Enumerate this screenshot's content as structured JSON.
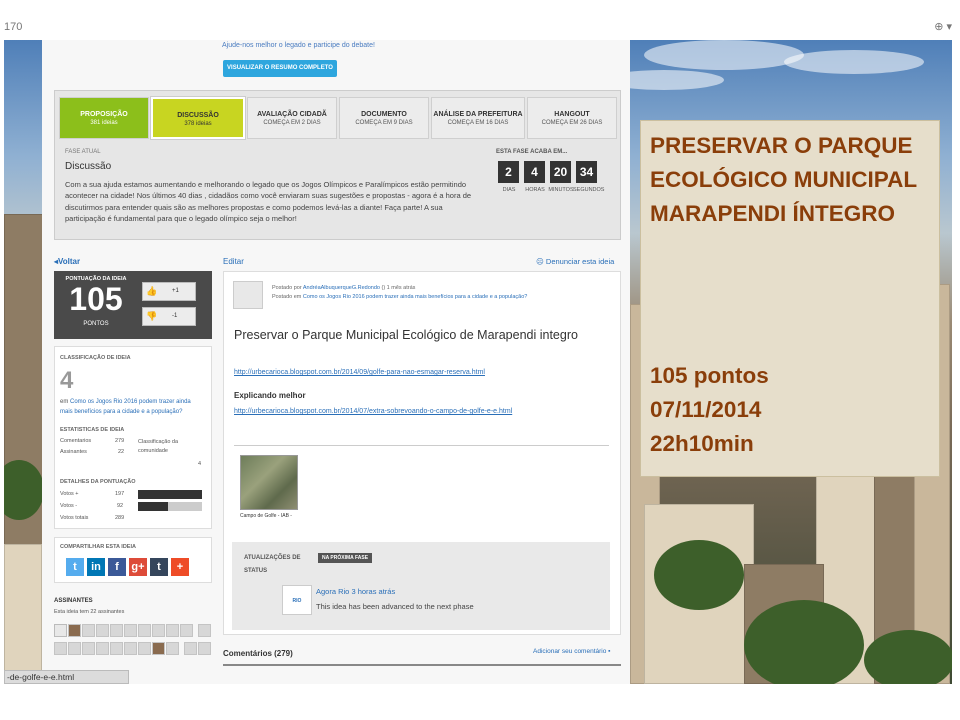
{
  "browser": {
    "url_fragment": "170"
  },
  "site": {
    "topline": "Ajude-nos melhor o legado e participe do debate!",
    "resumo_button": "VISUALIZAR O RESUMO COMPLETO",
    "phases": [
      {
        "label": "PROPOSIÇÃO",
        "sub": "381 ideias"
      },
      {
        "label": "DISCUSSÃO",
        "sub": "378 ideias"
      },
      {
        "label": "AVALIAÇÃO CIDADÃ",
        "sub": "COMEÇA EM 2 DIAS"
      },
      {
        "label": "DOCUMENTO",
        "sub": "COMEÇA EM 9 DIAS"
      },
      {
        "label": "ANÁLISE DA PREFEITURA",
        "sub": "COMEÇA EM 16 DIAS"
      },
      {
        "label": "HANGOUT",
        "sub": "COMEÇA EM 26 DIAS"
      }
    ],
    "fase_label": "FASE ATUAL",
    "fase_title": "Discussão",
    "fase_text": "Com a sua ajuda estamos aumentando e melhorando o legado que os Jogos Olímpicos e Paralímpicos estão permitindo acontecer na cidade! Nos últimos 40 dias , cidadãos como você enviaram suas sugestões e propostas - agora é a hora de discutirmos para entender quais são as melhores propostas e como podemos levá-las a diante! Faça parte! A sua participação é fundamental para que o legado olímpico seja o melhor!",
    "countdown": {
      "label": "ESTA FASE ACABA EM...",
      "items": [
        {
          "value": "2",
          "unit": "DIAS"
        },
        {
          "value": "4",
          "unit": "HORAS"
        },
        {
          "value": "20",
          "unit": "MINUTOS"
        },
        {
          "value": "34",
          "unit": "SEGUNDOS"
        }
      ]
    },
    "voltar": "◂Voltar",
    "editar": "Editar",
    "denunciar": "Denunciar esta ideia",
    "score": {
      "label": "PONTUAÇÃO DA IDEIA",
      "value": "105",
      "unit": "PONTOS",
      "up": "+1",
      "down": "-1"
    },
    "classification": {
      "heading": "CLASSIFICAÇÃO DE IDEIA",
      "value": "4",
      "text_prefix": "em ",
      "text_link": "Como os Jogos Rio 2016 podem trazer ainda mais benefícios para a cidade e a população?",
      "stats_heading": "ESTATISTICAS DE IDEIA",
      "comentarios_label": "Comentarios",
      "comentarios_value": "279",
      "classif_label": "Classificação da comunidade",
      "assinantes_label": "Assinantes",
      "assinantes_value": "22",
      "rank_value": "4",
      "detalhes_heading": "DETALHES DA PONTUAÇÃO",
      "votos_pos_label": "Votos +",
      "votos_pos_value": "197",
      "votos_pos_fraction": 1.0,
      "votos_neg_label": "Votos -",
      "votos_neg_value": "92",
      "votos_neg_fraction": 0.47,
      "votos_total_label": "Votos totais",
      "votos_total_value": "289"
    },
    "share": {
      "heading": "COMPARTILHAR ESTA IDEIA",
      "icons": [
        {
          "name": "twitter-icon",
          "glyph": "t",
          "color": "#55acee"
        },
        {
          "name": "linkedin-icon",
          "glyph": "in",
          "color": "#0077b5"
        },
        {
          "name": "facebook-icon",
          "glyph": "f",
          "color": "#3b5998"
        },
        {
          "name": "google-plus-icon",
          "glyph": "g+",
          "color": "#dd4b39"
        },
        {
          "name": "tumblr-icon",
          "glyph": "t",
          "color": "#35465c"
        },
        {
          "name": "add-share-icon",
          "glyph": "+",
          "color": "#ee4c27"
        }
      ]
    },
    "assinantes": {
      "heading": "ASSINANTES",
      "text": "Esta ideia tem 22 assinantes"
    },
    "idea": {
      "posted_line1_prefix": "Postado por ",
      "posted_author": "AndréaAlbuquerqueG.Redondo",
      "posted_line1_suffix": " () 1 mês atrás",
      "posted_line2_prefix": "Postado em ",
      "posted_topic": "Como os Jogos Rio 2016 podem trazer ainda mais benefícios para a cidade e a população?",
      "title": "Preservar o Parque Municipal Ecológico de Marapendi integro",
      "url1": "http://urbecarioca.blogspot.com.br/2014/09/golfe-para-nao-esmagar-reserva.html",
      "subtitle": "Explicando melhor",
      "url2": "http://urbecarioca.blogspot.com.br/2014/07/extra-sobrevoando-o-campo-de-golfe-e-e.html",
      "image_caption": "Campo de Golfe - IAB -"
    },
    "status": {
      "label": "ATUALIZAÇÕES DE STATUS",
      "badge": "NA PRÓXIMA FASE",
      "logo_text": "RIO",
      "author": "Agora Rio",
      "time": " 3 horas atrás",
      "message": "This idea has been advanced to the next phase"
    },
    "comments_heading": "Comentários (279)",
    "add_comment": "Adicionar seu comentário"
  },
  "url_tooltip": "-de-golfe-e-e.html",
  "overlay": {
    "title": "PRESERVAR O PARQUE ECOLÓGICO MUNICIPAL MARAPENDI ÍNTEGRO",
    "points": "105 pontos",
    "date": "07/11/2014",
    "time": "22h10min"
  }
}
